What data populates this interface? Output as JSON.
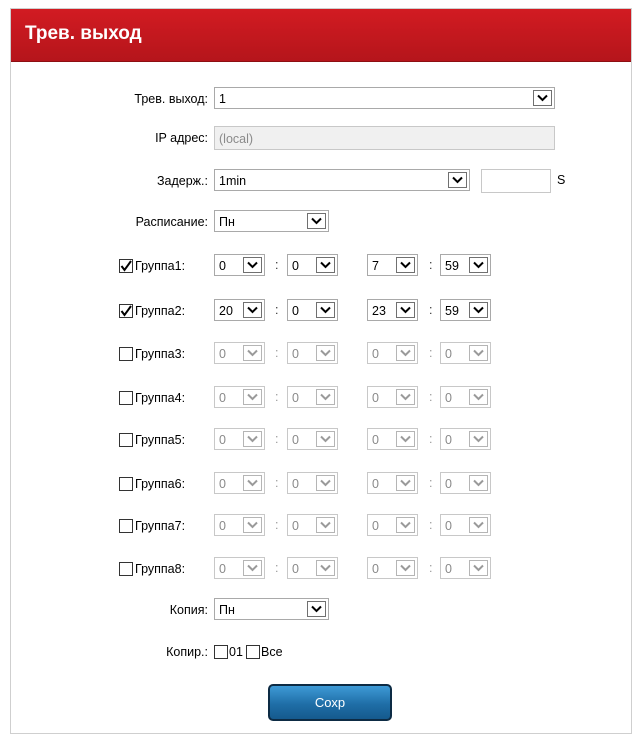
{
  "title": "Трев. выход",
  "alarm_output": {
    "label": "Трев. выход:",
    "value": "1"
  },
  "ip": {
    "label": "IP адрес:",
    "value": "(local)"
  },
  "delay": {
    "label": "Задерж.:",
    "value": "1min",
    "extra": "",
    "unit": "S"
  },
  "schedule": {
    "label": "Расписание:",
    "value": "Пн"
  },
  "groups": [
    {
      "label": "Группа1:",
      "checked": true,
      "sh": "0",
      "sm": "0",
      "eh": "7",
      "em": "59"
    },
    {
      "label": "Группа2:",
      "checked": true,
      "sh": "20",
      "sm": "0",
      "eh": "23",
      "em": "59"
    },
    {
      "label": "Группа3:",
      "checked": false,
      "sh": "0",
      "sm": "0",
      "eh": "0",
      "em": "0"
    },
    {
      "label": "Группа4:",
      "checked": false,
      "sh": "0",
      "sm": "0",
      "eh": "0",
      "em": "0"
    },
    {
      "label": "Группа5:",
      "checked": false,
      "sh": "0",
      "sm": "0",
      "eh": "0",
      "em": "0"
    },
    {
      "label": "Группа6:",
      "checked": false,
      "sh": "0",
      "sm": "0",
      "eh": "0",
      "em": "0"
    },
    {
      "label": "Группа7:",
      "checked": false,
      "sh": "0",
      "sm": "0",
      "eh": "0",
      "em": "0"
    },
    {
      "label": "Группа8:",
      "checked": false,
      "sh": "0",
      "sm": "0",
      "eh": "0",
      "em": "0"
    }
  ],
  "colon": ":",
  "copy_from": {
    "label": "Копия:",
    "value": "Пн"
  },
  "copy_to": {
    "label": "Копир.:",
    "opt1": "01",
    "opt2": "Все"
  },
  "save_label": "Сохр"
}
